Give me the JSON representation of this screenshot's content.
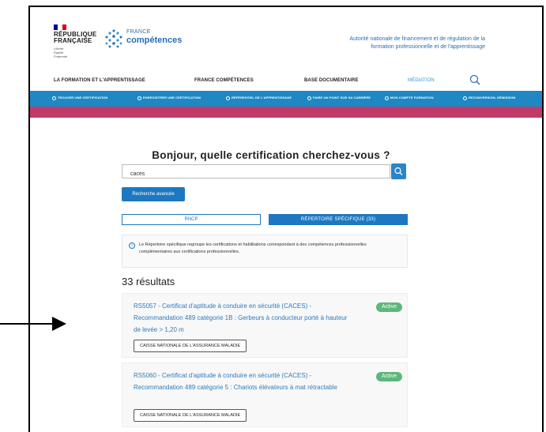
{
  "header": {
    "republique_line1": "RÉPUBLIQUE",
    "republique_line2": "FRANÇAISE",
    "motto": "Liberté\nÉgalité\nFraternité",
    "brand_small": "FRANCE",
    "brand_big": "compétences",
    "authority_line1": "Autorité nationale de financement et de régulation de la",
    "authority_line2": "formation professionnelle et de l'apprentissage"
  },
  "main_nav": {
    "items": [
      {
        "label": "LA FORMATION ET L'APPRENTISSAGE"
      },
      {
        "label": "FRANCE COMPÉTENCES"
      },
      {
        "label": "BASE DOCUMENTAIRE"
      },
      {
        "label": "MÉDIATION"
      }
    ]
  },
  "toolbar": {
    "items": [
      {
        "label": "TROUVER UNE CERTIFICATION"
      },
      {
        "label": "ENREGISTRER UNE CERTIFICATION"
      },
      {
        "label": "RÉFÉRENTIEL DE L'APPRENTISSAGE"
      },
      {
        "label": "FAIRE UN POINT SUR SA CARRIÈRE"
      },
      {
        "label": "MON COMPTE FORMATION"
      },
      {
        "label": "RECONVERSION, DÉMISSION"
      }
    ]
  },
  "search": {
    "heading": "Bonjour, quelle certification cherchez-vous ?",
    "query": "caces",
    "advanced_label": "Recherche avancée"
  },
  "tabs": {
    "rncp": "RNCP",
    "rs": "RÉPERTOIRE SPÉCIFIQUE (33)"
  },
  "info": {
    "text": "Le Répertoire spécifique regroupe les certifications et habilitations correspondant à des compétences professionnelles complémentaires aux certifications professionnelles."
  },
  "results": {
    "count_label": "33 résultats",
    "items": [
      {
        "title": "RS5057 - Certificat d'aptitude à conduire en sécurité (CACES) - Recommandation 489 catégorie 1B : Gerbeurs à conducteur porté à hauteur de levée > 1,20 m",
        "status": "Active",
        "organization": "CAISSE NATIONALE DE L'ASSURANCE MALADIE"
      },
      {
        "title": "RS5060 - Certificat d'aptitude à conduire en sécurité (CACES) - Recommandation 489 catégorie 5 : Chariots élévateurs à mat rétractable",
        "status": "Active",
        "organization": "CAISSE NATIONALE DE L'ASSURANCE MALADIE"
      }
    ]
  },
  "colors": {
    "primary_blue": "#1d78c1",
    "toolbar_blue": "#1d88c3",
    "accent_pink": "#c13a6a",
    "active_green": "#5cb87a",
    "link_blue": "#2c7bbf"
  },
  "icons": {
    "search": "search-icon",
    "info": "info-icon",
    "arrow": "arrow-right-icon"
  }
}
